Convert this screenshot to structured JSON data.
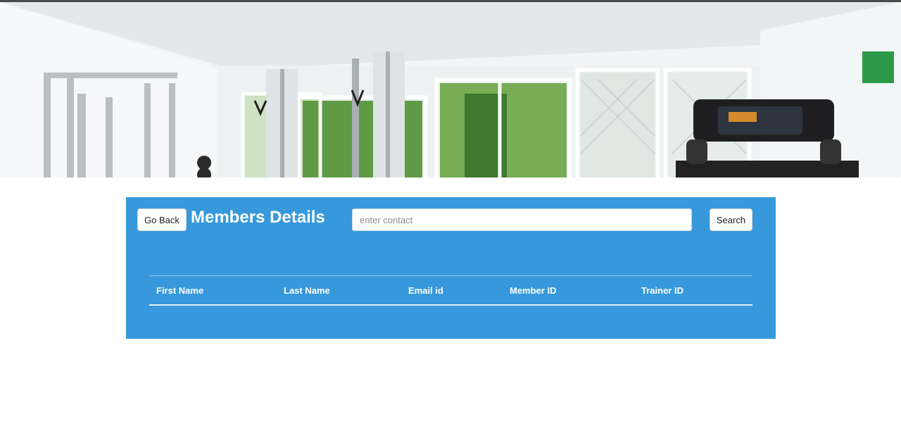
{
  "header": {
    "banner_image": "gym-interior-photo"
  },
  "panel": {
    "go_back_label": "Go Back",
    "title": "Members Details",
    "search_placeholder": "enter contact",
    "search_value": "",
    "search_label": "Search",
    "accent_color": "#3799db"
  },
  "table": {
    "columns": [
      "First Name",
      "Last Name",
      "Email id",
      "Member ID",
      "Trainer ID"
    ],
    "rows": []
  }
}
